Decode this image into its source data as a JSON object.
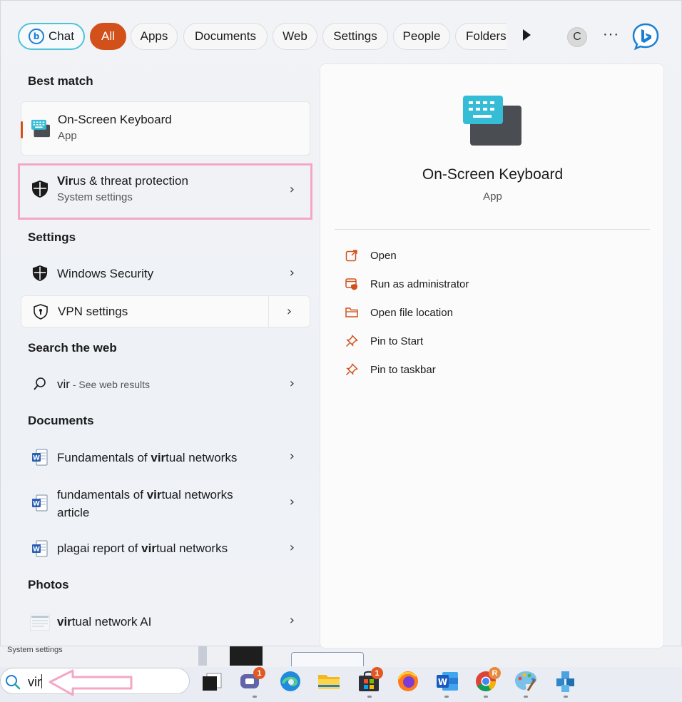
{
  "filters": {
    "chat": "Chat",
    "all": "All",
    "apps": "Apps",
    "documents": "Documents",
    "web": "Web",
    "settings": "Settings",
    "people": "People",
    "folders": "Folders",
    "avatar_letter": "C",
    "more": "···"
  },
  "best_match": {
    "title": "Best match",
    "item": {
      "name": "On-Screen Keyboard",
      "type": "App"
    }
  },
  "virus": {
    "bold": "Vir",
    "rest": "us & threat protection",
    "sub": "System settings"
  },
  "settings_section": {
    "title": "Settings",
    "items": [
      {
        "label": "Windows Security"
      },
      {
        "label": "VPN settings"
      }
    ]
  },
  "web_section": {
    "title": "Search the web",
    "query": "vir",
    "suffix": " - See web results"
  },
  "documents_section": {
    "title": "Documents",
    "items": [
      {
        "pre": "Fundamentals of ",
        "bold": "vir",
        "post": "tual networks"
      },
      {
        "pre": "fundamentals of ",
        "bold": "vir",
        "post": "tual networks",
        "line2": "article"
      },
      {
        "pre": "plagai report of ",
        "bold": "vir",
        "post": "tual networks"
      }
    ]
  },
  "photos_section": {
    "title": "Photos",
    "items": [
      {
        "bold": "vir",
        "post": "tual network AI"
      }
    ]
  },
  "preview": {
    "title": "On-Screen Keyboard",
    "subtitle": "App",
    "actions": [
      {
        "label": "Open",
        "icon": "open-external-icon"
      },
      {
        "label": "Run as administrator",
        "icon": "shield-admin-icon"
      },
      {
        "label": "Open file location",
        "icon": "folder-icon"
      },
      {
        "label": "Pin to Start",
        "icon": "pin-icon"
      },
      {
        "label": "Pin to taskbar",
        "icon": "pin-icon"
      }
    ]
  },
  "background": {
    "caption": "System settings"
  },
  "taskbar": {
    "search_value": "vir",
    "badges": {
      "teams": "1",
      "store": "1",
      "chrome": "R"
    }
  },
  "colors": {
    "accent": "#d2511a",
    "highlight": "#f4a7c4",
    "chat_ring": "#4fc3d6"
  }
}
